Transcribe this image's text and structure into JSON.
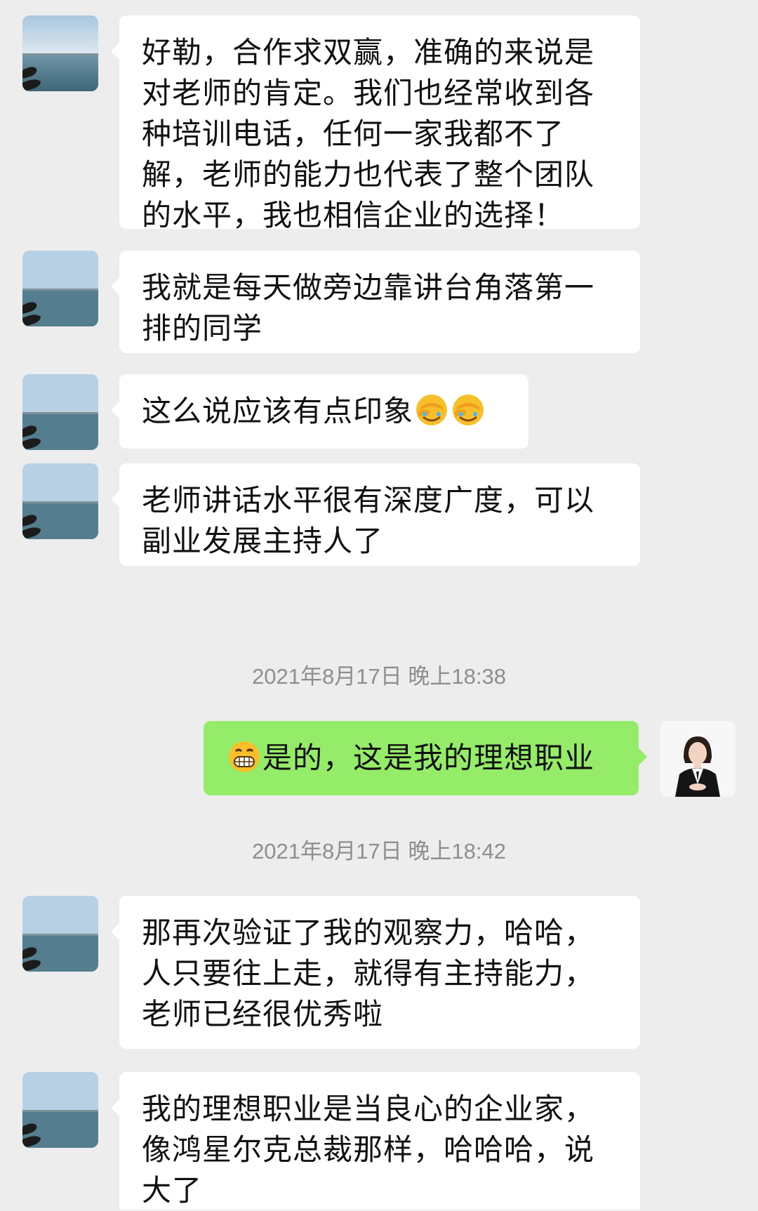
{
  "colors": {
    "background": "#ededed",
    "incoming_bubble": "#ffffff",
    "outgoing_bubble": "#95ec69",
    "timestamp_text": "#8e8e8e"
  },
  "messages": [
    {
      "direction": "incoming",
      "avatar": "lake-landscape-avatar",
      "text": "好勒，合作求双赢，准确的来说是对老师的肯定。我们也经常收到各种培训电话，任何一家我都不了解，老师的能力也代表了整个团队的水平，我也相信企业的选择！"
    },
    {
      "direction": "incoming",
      "avatar": "lake-landscape-avatar",
      "text": "我就是每天做旁边靠讲台角落第一排的同学"
    },
    {
      "direction": "incoming",
      "avatar": "lake-landscape-avatar",
      "text": "这么说应该有点印象",
      "trailing_icons": [
        "facepalm-emoji",
        "facepalm-emoji"
      ]
    },
    {
      "direction": "incoming",
      "avatar": "lake-landscape-avatar",
      "text": "老师讲话水平很有深度广度，可以副业发展主持人了"
    },
    {
      "type": "timestamp",
      "text": "2021年8月17日 晚上18:38"
    },
    {
      "direction": "outgoing",
      "avatar": "woman-in-suit-avatar",
      "leading_icon": "grin-emoji",
      "text": "是的，这是我的理想职业"
    },
    {
      "type": "timestamp",
      "text": "2021年8月17日 晚上18:42"
    },
    {
      "direction": "incoming",
      "avatar": "lake-landscape-avatar",
      "text": "那再次验证了我的观察力，哈哈，人只要往上走，就得有主持能力，老师已经很优秀啦"
    },
    {
      "direction": "incoming",
      "avatar": "lake-landscape-avatar",
      "text": "我的理想职业是当良心的企业家，像鸿星尔克总裁那样，哈哈哈，说大了"
    }
  ]
}
